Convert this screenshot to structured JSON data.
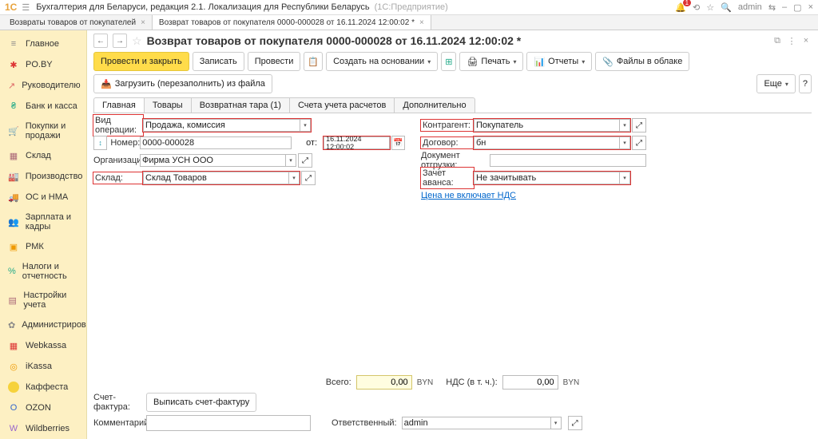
{
  "titlebar": {
    "logo": "1C",
    "title": "Бухгалтерия для Беларуси, редакция 2.1. Локализация для Республики Беларусь",
    "subtitle": "(1С:Предприятие)",
    "user": "admin",
    "bell_count": "1"
  },
  "wtabs": [
    {
      "label": "Возвраты товаров от покупателей"
    },
    {
      "label": "Возврат товаров от покупателя 0000-000028 от 16.11.2024 12:00:02 *"
    }
  ],
  "sidebar": [
    {
      "ico": "≡",
      "cls": "c-gray",
      "label": "Главное"
    },
    {
      "ico": "✱",
      "cls": "c-red",
      "label": "PO.BY"
    },
    {
      "ico": "↗",
      "cls": "c-pink",
      "label": "Руководителю"
    },
    {
      "ico": "₴",
      "cls": "c-green",
      "label": "Банк и касса"
    },
    {
      "ico": "🛒",
      "cls": "c-cyan",
      "label": "Покупки и продажи"
    },
    {
      "ico": "▦",
      "cls": "c-brown",
      "label": "Склад"
    },
    {
      "ico": "🏭",
      "cls": "c-gray",
      "label": "Производство"
    },
    {
      "ico": "🚚",
      "cls": "c-gray",
      "label": "ОС и НМА"
    },
    {
      "ico": "👥",
      "cls": "c-blue",
      "label": "Зарплата и кадры"
    },
    {
      "ico": "▣",
      "cls": "c-orange",
      "label": "РМК"
    },
    {
      "ico": "%",
      "cls": "c-green",
      "label": "Налоги и отчетность"
    },
    {
      "ico": "▤",
      "cls": "c-brown",
      "label": "Настройки учета"
    },
    {
      "ico": "✿",
      "cls": "c-gray",
      "label": "Администрирование"
    },
    {
      "ico": "▦",
      "cls": "c-red",
      "label": "Webkassa"
    },
    {
      "ico": "◎",
      "cls": "c-orange",
      "label": "iKassa"
    },
    {
      "ico": "",
      "cls": "",
      "label": "Каффеста",
      "dot": true
    },
    {
      "ico": "O",
      "cls": "c-blue",
      "label": "OZON"
    },
    {
      "ico": "W",
      "cls": "c-purple",
      "label": "Wildberries"
    }
  ],
  "header": {
    "back": "←",
    "fwd": "→",
    "title": "Возврат товаров от покупателя 0000-000028 от 16.11.2024 12:00:02 *"
  },
  "toolbar": {
    "post_close": "Провести и закрыть",
    "save": "Записать",
    "post": "Провести",
    "create_on": "Создать на основании",
    "print": "Печать",
    "reports": "Отчеты",
    "files": "Файлы в облаке",
    "load": "Загрузить (перезаполнить) из файла",
    "more": "Еще"
  },
  "tabs": [
    {
      "label": "Главная",
      "active": true
    },
    {
      "label": "Товары"
    },
    {
      "label": "Возвратная тара (1)"
    },
    {
      "label": "Счета учета расчетов"
    },
    {
      "label": "Дополнительно"
    }
  ],
  "form": {
    "left": {
      "vid_op": {
        "label": "Вид операции:",
        "value": "Продажа, комиссия"
      },
      "nomer": {
        "label": "Номер:",
        "value": "0000-000028",
        "ot": "от:",
        "date": "16.11.2024 12:00:02"
      },
      "org": {
        "label": "Организация:",
        "value": "Фирма УСН ООО"
      },
      "sklad": {
        "label": "Склад:",
        "value": "Склад Товаров"
      }
    },
    "right": {
      "kontr": {
        "label": "Контрагент:",
        "value": "Покупатель"
      },
      "dog": {
        "label": "Договор:",
        "value": "бн"
      },
      "doc": {
        "label": "Документ отгрузки:",
        "value": ""
      },
      "avans": {
        "label": "Зачет аванса:",
        "value": "Не зачитывать"
      },
      "link": "Цена не включает НДС"
    }
  },
  "footer": {
    "vsego": "Всего:",
    "vsego_val": "0,00",
    "cur": "BYN",
    "nds": "НДС (в т. ч.):",
    "nds_val": "0,00",
    "schet": "Счет-фактура:",
    "schet_btn": "Выписать счет-фактуру",
    "comment": "Комментарий:",
    "resp": "Ответственный:",
    "resp_val": "admin"
  },
  "chart_data": null
}
